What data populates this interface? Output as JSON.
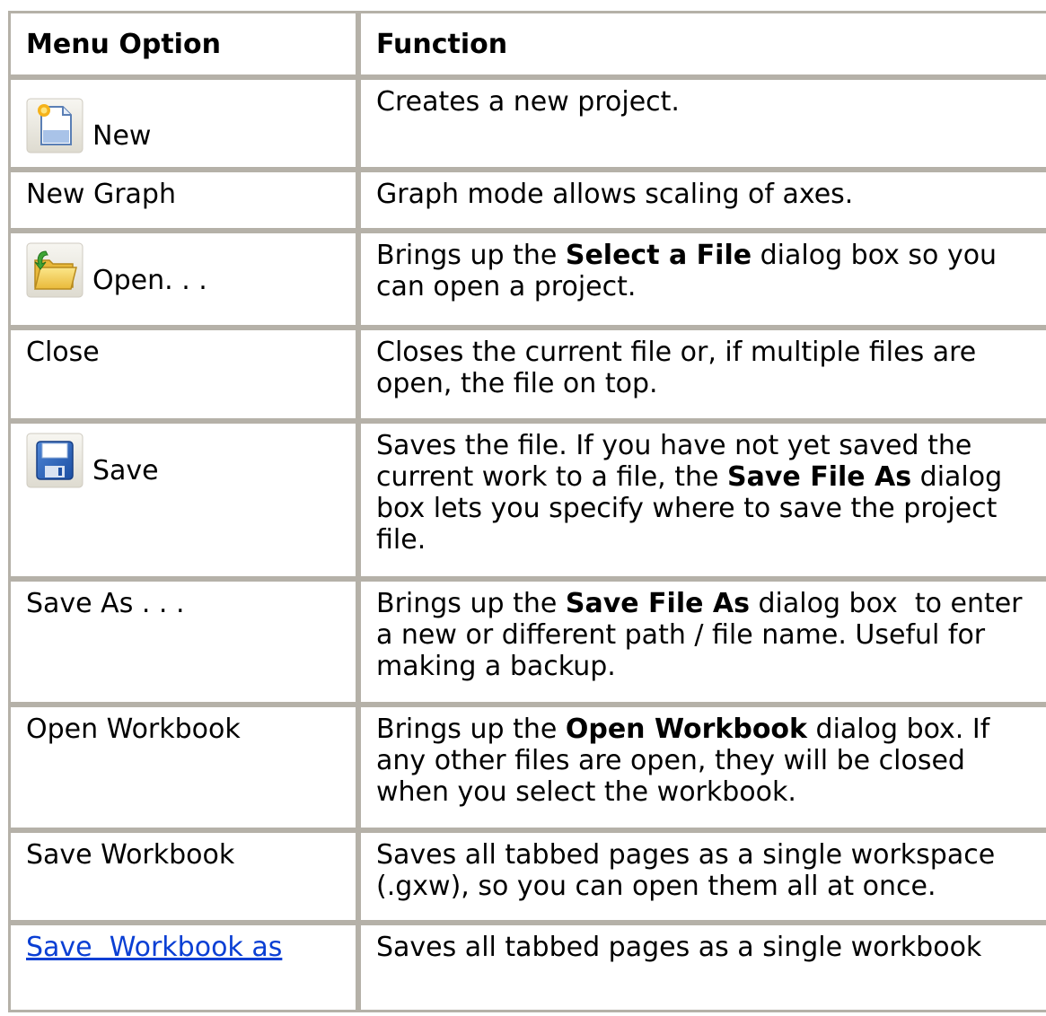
{
  "table": {
    "headers": [
      "Menu Option",
      "Function"
    ],
    "rows": [
      {
        "option": "New",
        "icon": "new-file-icon",
        "desc": [
          "Creates a new project."
        ]
      },
      {
        "option": "New Graph",
        "desc": [
          "Graph mode allows scaling of axes."
        ]
      },
      {
        "option": "Open. . .",
        "icon": "open-folder-icon",
        "desc": [
          "Brings up the ",
          "Select a File",
          " dialog box so you can open a project."
        ]
      },
      {
        "option": "Close",
        "desc": [
          "Closes the current file or, if multiple files are open, the file on top."
        ]
      },
      {
        "option": "Save",
        "icon": "floppy-disk-icon",
        "desc": [
          "Saves the file. If you have not yet saved the current work to a file, the ",
          "Save File As",
          " dialog box lets you specify where to save the project file."
        ]
      },
      {
        "option": "Save As . . .",
        "desc": [
          "Brings up the ",
          "Save File As",
          " dialog box  to enter a new or different path / file name. Useful for making a backup."
        ]
      },
      {
        "option": "Open Workbook",
        "desc": [
          "Brings up the ",
          "Open Workbook",
          " dialog box. If any other files are open, they will be closed when you select the workbook."
        ]
      },
      {
        "option": "Save Workbook",
        "desc": [
          "Saves all tabbed pages as a single workspace (.gxw), so you can open them all at once."
        ]
      },
      {
        "option": "Save  Workbook as",
        "desc": [
          "Saves all tabbed pages as a single workbook"
        ]
      }
    ]
  },
  "colors": {
    "border": "#b5b1a8",
    "link": "#0a3fd4"
  }
}
